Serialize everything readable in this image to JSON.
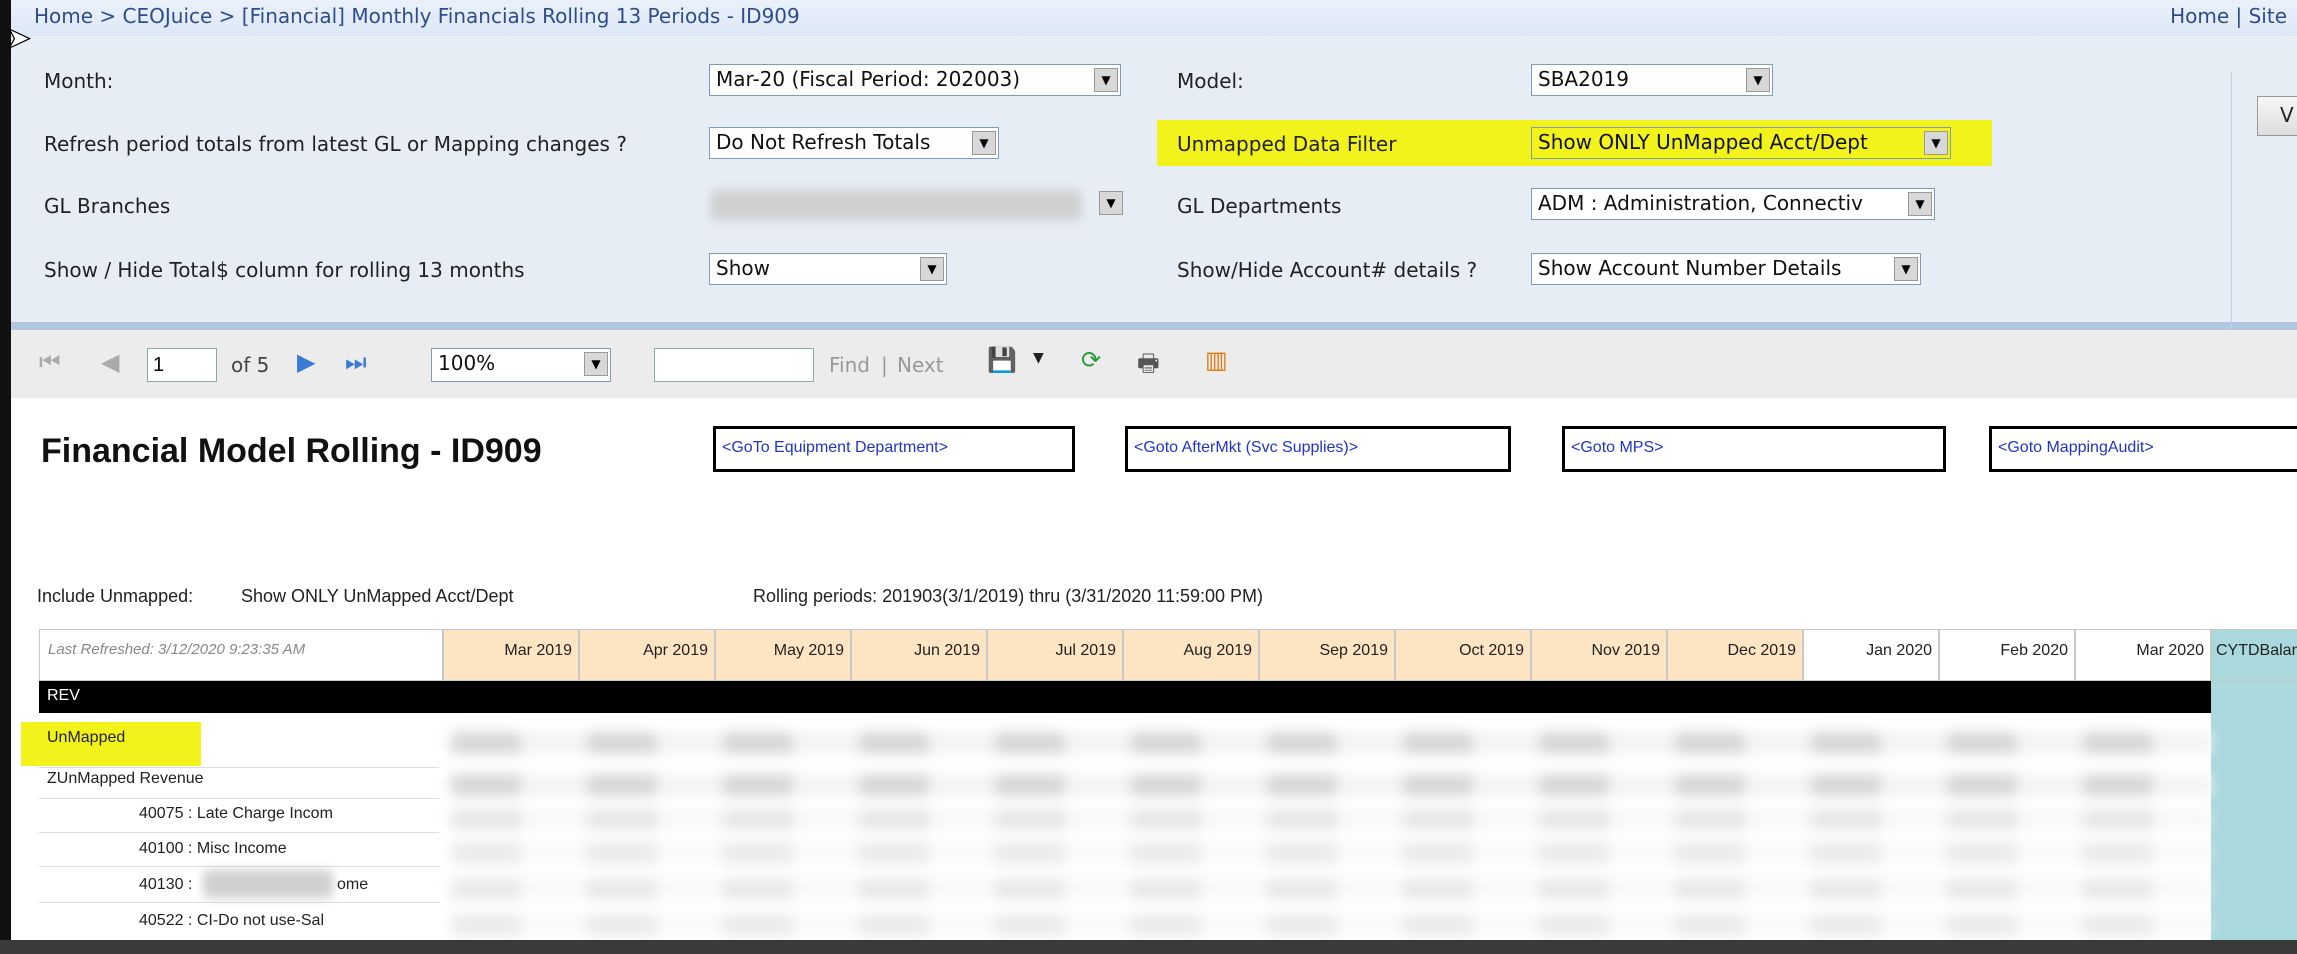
{
  "breadcrumb": "Home > CEOJuice > [Financial] Monthly Financials Rolling 13 Periods - ID909",
  "top_links": "Home | Site",
  "params": {
    "month_label": "Month:",
    "month_value": "Mar-20  (Fiscal Period: 202003)",
    "refresh_label": "Refresh period totals from latest GL or Mapping changes ?",
    "refresh_value": "Do Not Refresh Totals",
    "branches_label": "GL Branches",
    "showhide_label": "Show / Hide Total$ column for rolling 13 months",
    "showhide_value": "Show",
    "model_label": "Model:",
    "model_value": "SBA2019",
    "unmapped_label": "Unmapped Data Filter",
    "unmapped_value": "Show ONLY UnMapped Acct/Dept",
    "departments_label": "GL Departments",
    "departments_value": "ADM : Administration, Connectiv",
    "account_label": "Show/Hide Account# details ?",
    "account_value": "Show Account Number Details",
    "view_button": "V"
  },
  "toolbar": {
    "page_value": "1",
    "page_of": "of 5",
    "zoom": "100%",
    "find": "Find",
    "separator": "|",
    "next": "Next"
  },
  "report": {
    "title": "Financial Model Rolling - ID909",
    "goto_links": [
      "<GoTo Equipment Department>",
      "<Goto AfterMkt (Svc Supplies)>",
      "<Goto MPS>",
      "<Goto MappingAudit>"
    ],
    "include_label": "Include Unmapped:",
    "include_value": "Show ONLY UnMapped Acct/Dept",
    "rolling": "Rolling periods: 201903(3/1/2019) thru (3/31/2020 11:59:00 PM)",
    "last_refreshed": "Last Refreshed: 3/12/2020 9:23:35 AM",
    "months": [
      "Mar 2019",
      "Apr 2019",
      "May 2019",
      "Jun 2019",
      "Jul 2019",
      "Aug 2019",
      "Sep 2019",
      "Oct 2019",
      "Nov 2019",
      "Dec 2019",
      "Jan 2020",
      "Feb 2020",
      "Mar 2020"
    ],
    "cytd_header": "CYTDBalan",
    "section": "REV",
    "rows": [
      "UnMapped",
      "ZUnMapped Revenue",
      "40075 : Late Charge Incom",
      "40100 : Misc Income",
      "40130 :",
      "ome",
      "40522 : CI-Do not use-Sal"
    ]
  },
  "colors": {
    "highlight": "#f1f31b",
    "month_header": "#fde4c3",
    "cytd": "#a9d8dd",
    "link": "#2233cc"
  }
}
